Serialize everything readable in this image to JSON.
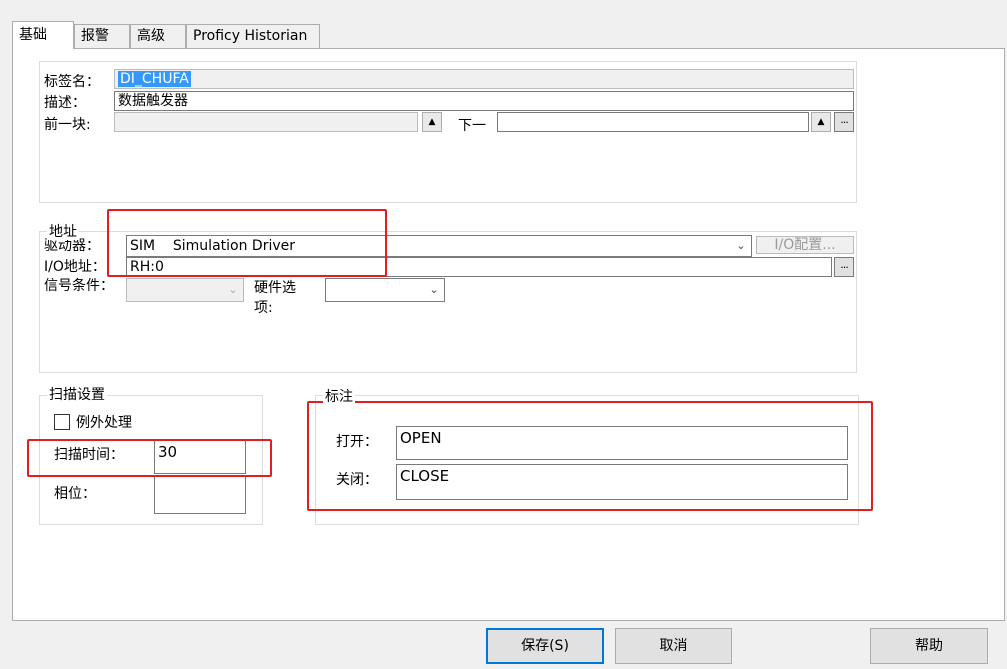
{
  "tabs": [
    {
      "label": "基础",
      "active": true
    },
    {
      "label": "报警",
      "active": false
    },
    {
      "label": "高级",
      "active": false
    },
    {
      "label": "Proficy Historian",
      "active": false
    }
  ],
  "basic": {
    "tag_name_label": "标签名：",
    "tag_name_value": "DI_CHUFA",
    "desc_label": "描述：",
    "desc_value": "数据触发器",
    "prev_block_label": "前一块:",
    "prev_block_value": "",
    "next_label": "下一",
    "next_value": "",
    "browse_glyph": "..."
  },
  "address": {
    "group_label": "地址",
    "driver_label": "驱动器：",
    "driver_value": "SIM    Simulation Driver",
    "io_config_label": "I/O配置...",
    "io_addr_label": "I/O地址：",
    "io_addr_value": "RH:0",
    "signal_label": "信号条件：",
    "signal_value": "",
    "hw_label_line1": "硬件选",
    "hw_label_line2": "项:",
    "hw_value": ""
  },
  "scan": {
    "group_label": "扫描设置",
    "exception_label": "例外处理",
    "exception_checked": false,
    "scan_time_label": "扫描时间：",
    "scan_time_value": "30",
    "phase_label": "相位：",
    "phase_value": ""
  },
  "annotation": {
    "group_label": "标注",
    "open_label": "打开：",
    "open_value": "OPEN",
    "close_label": "关闭：",
    "close_value": "CLOSE"
  },
  "buttons": {
    "save": "保存(S)",
    "cancel": "取消",
    "help": "帮助"
  },
  "colors": {
    "highlight_box": "#e02020",
    "selection": "#3399ff"
  }
}
